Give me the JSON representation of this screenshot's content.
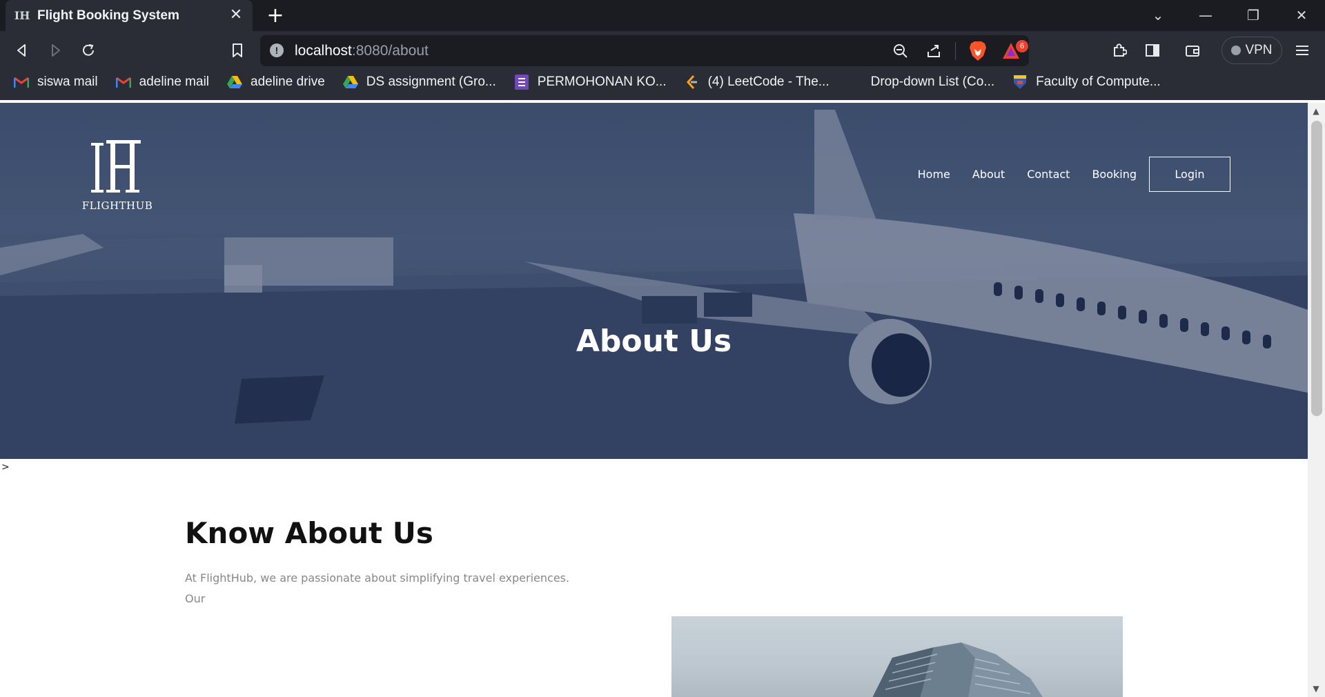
{
  "browser": {
    "tab_title": "Flight Booking System",
    "new_tab_icon": "plus-icon",
    "url_host": "localhost",
    "url_path": ":8080/about",
    "rewards_count": "6",
    "vpn_label": "VPN",
    "bookmarks": [
      {
        "label": "siswa mail",
        "icon": "gmail-icon"
      },
      {
        "label": "adeline mail",
        "icon": "gmail-icon"
      },
      {
        "label": "adeline drive",
        "icon": "google-drive-icon"
      },
      {
        "label": "DS assignment (Gro...",
        "icon": "google-drive-icon"
      },
      {
        "label": "PERMOHONAN KO...",
        "icon": "google-forms-icon"
      },
      {
        "label": "(4) LeetCode - The...",
        "icon": "leetcode-icon"
      },
      {
        "label": "Drop-down List (Co...",
        "icon": "blank-page-icon"
      },
      {
        "label": "Faculty of Compute...",
        "icon": "university-crest-icon"
      }
    ]
  },
  "site": {
    "logo_text": "FLIGHTHUB",
    "nav": [
      "Home",
      "About",
      "Contact",
      "Booking"
    ],
    "login_label": "Login",
    "hero_title": "About Us",
    "stray_char": ">",
    "about_heading": "Know About Us",
    "about_paragraph": "At FlightHub, we are passionate about simplifying travel experiences. Our"
  },
  "colors": {
    "hero_overlay": "#14234b",
    "chrome_dark": "#1a1c22",
    "chrome": "#2a2d35",
    "brave_orange": "#fb542b"
  }
}
